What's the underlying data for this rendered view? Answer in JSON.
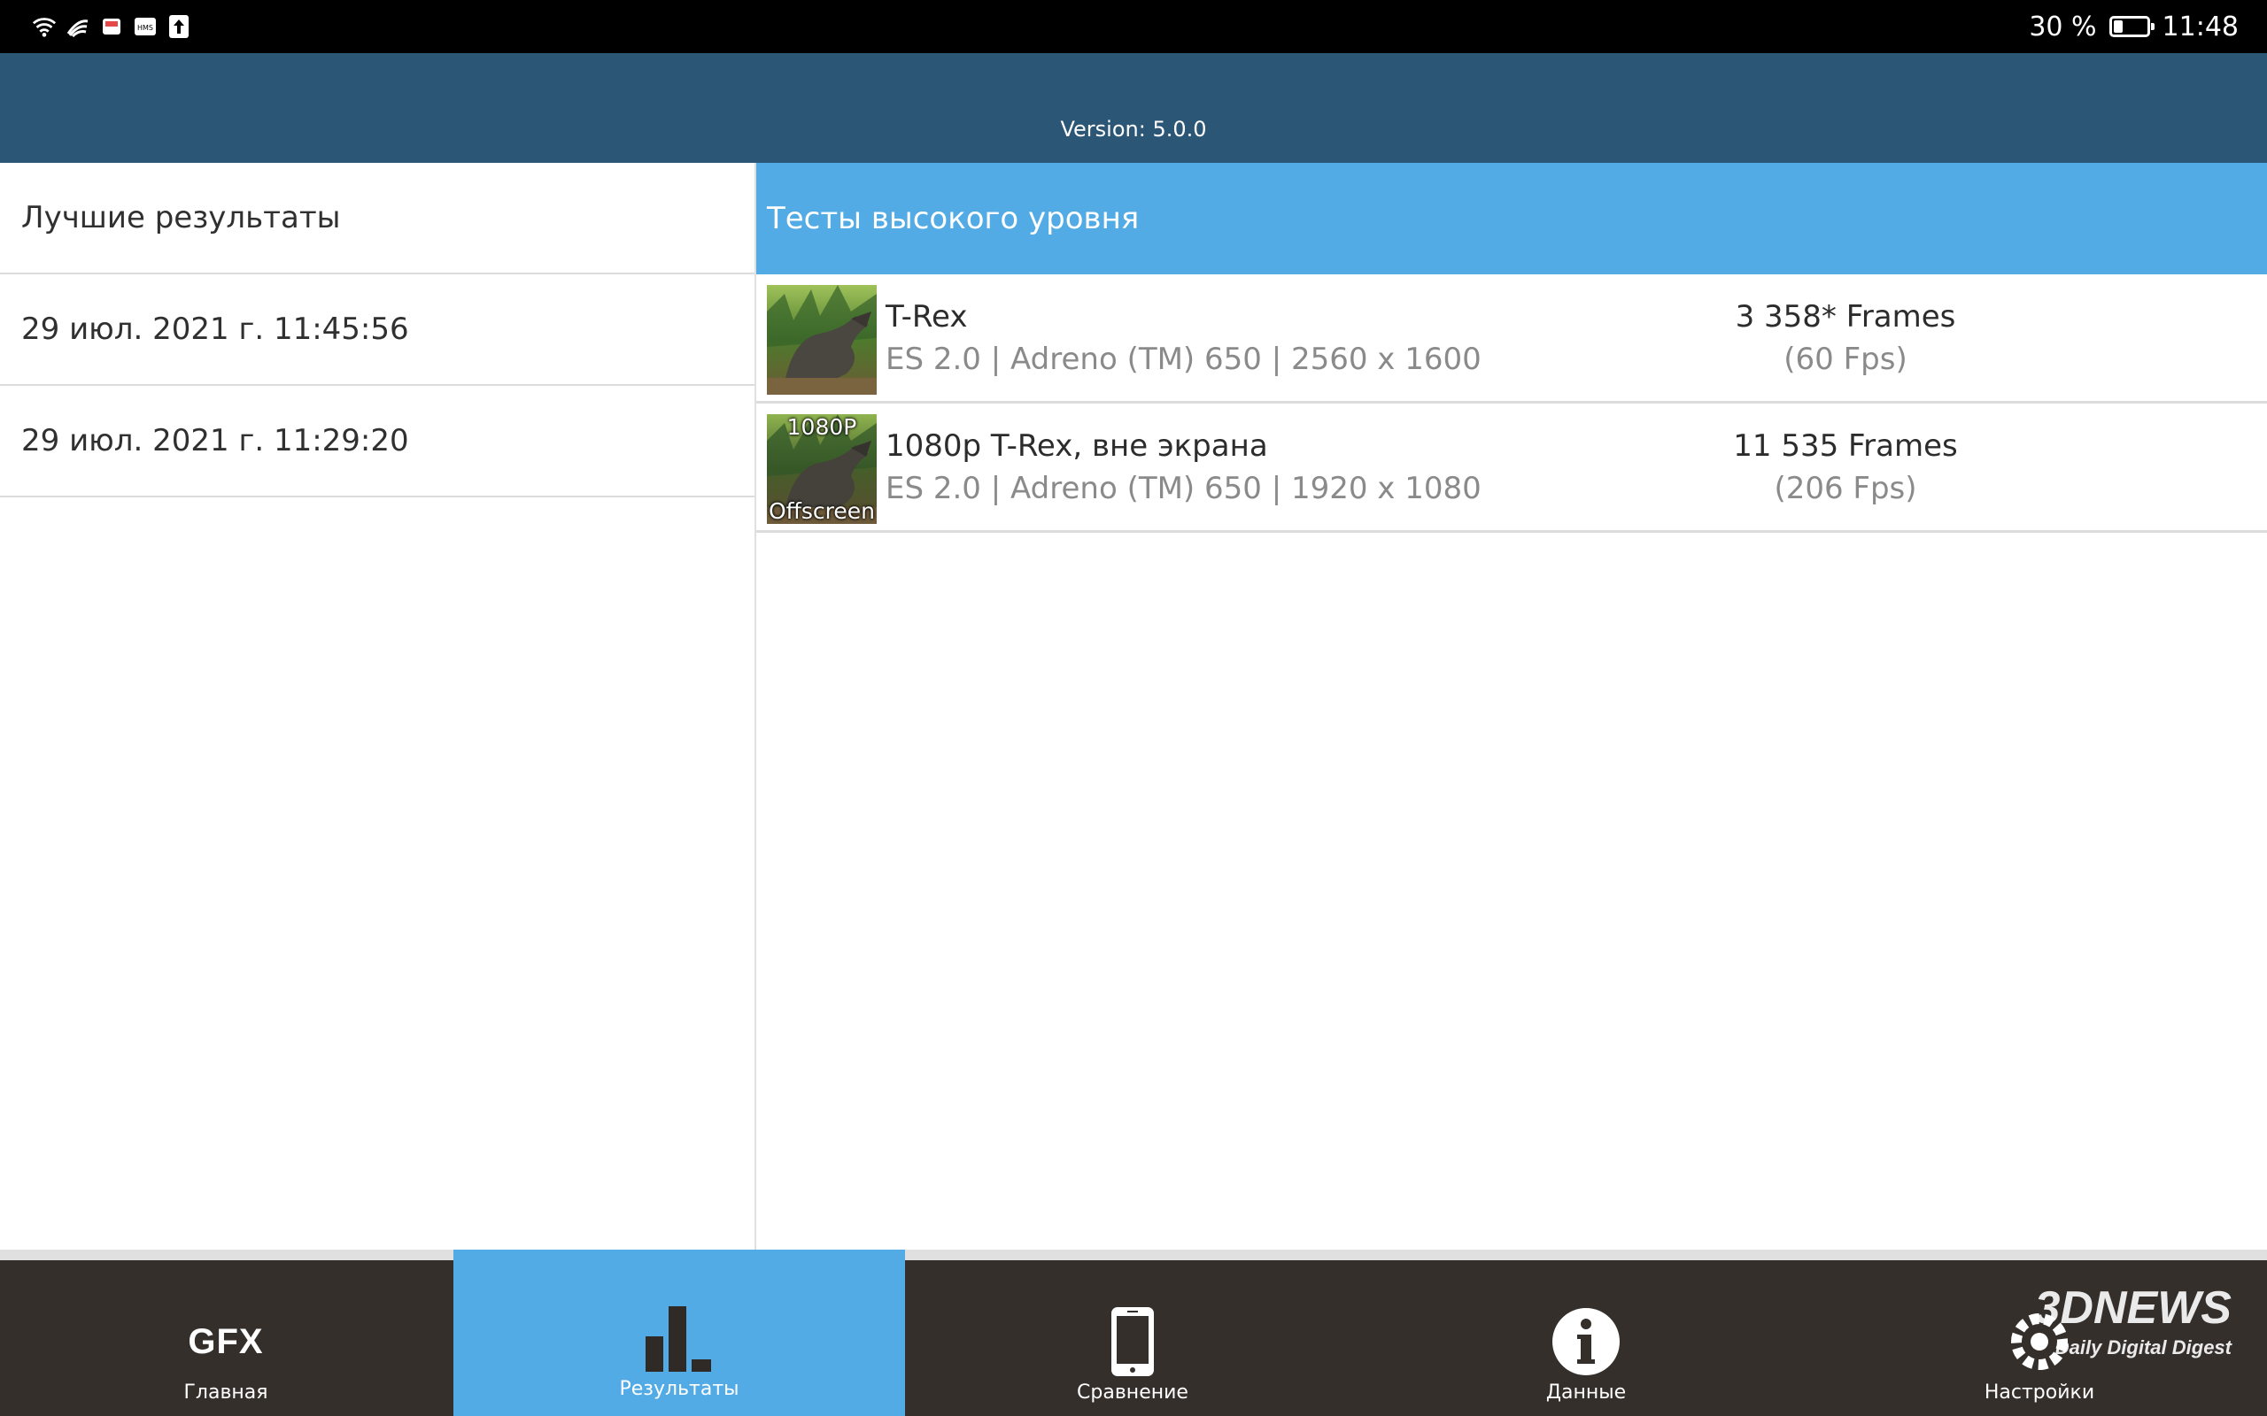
{
  "status_bar": {
    "battery_text": "30 %",
    "battery_level": 0.3,
    "time": "11:48",
    "icons": [
      "wifi-icon",
      "signal-icon",
      "mail-app-icon",
      "hms-icon",
      "upload-icon"
    ]
  },
  "header": {
    "version": "Version: 5.0.0"
  },
  "left_panel": {
    "title": "Лучшие результаты",
    "entries": [
      {
        "label": "29 июл. 2021 г. 11:45:56"
      },
      {
        "label": "29 июл. 2021 г. 11:29:20"
      }
    ]
  },
  "right_panel": {
    "title": "Тесты высокого уровня",
    "results": [
      {
        "name": "T-Rex",
        "details": "ES 2.0 | Adreno (TM) 650 | 2560 x 1600",
        "score": "3 358* Frames",
        "fps": "(60 Fps)",
        "thumb_top": "",
        "thumb_bottom": ""
      },
      {
        "name": "1080p T-Rex, вне экрана",
        "details": "ES 2.0 | Adreno (TM) 650 | 1920 x 1080",
        "score": "11 535 Frames",
        "fps": "(206 Fps)",
        "thumb_top": "1080P",
        "thumb_bottom": "Offscreen"
      }
    ]
  },
  "bottom_nav": {
    "items": [
      {
        "label": "Главная",
        "icon": "gfx-logo-icon",
        "icon_text": "GFX",
        "active": false
      },
      {
        "label": "Результаты",
        "icon": "bar-chart-icon",
        "active": true
      },
      {
        "label": "Сравнение",
        "icon": "phone-icon",
        "active": false
      },
      {
        "label": "Данные",
        "icon": "info-icon",
        "active": false
      },
      {
        "label": "Настройки",
        "icon": "settings-icon",
        "active": false
      }
    ]
  },
  "watermark": {
    "main": "3DNEWS",
    "sub": "Daily Digital Digest"
  },
  "colors": {
    "header_bg": "#2c5675",
    "accent": "#53abe6",
    "nav_bg": "#342f2b"
  }
}
